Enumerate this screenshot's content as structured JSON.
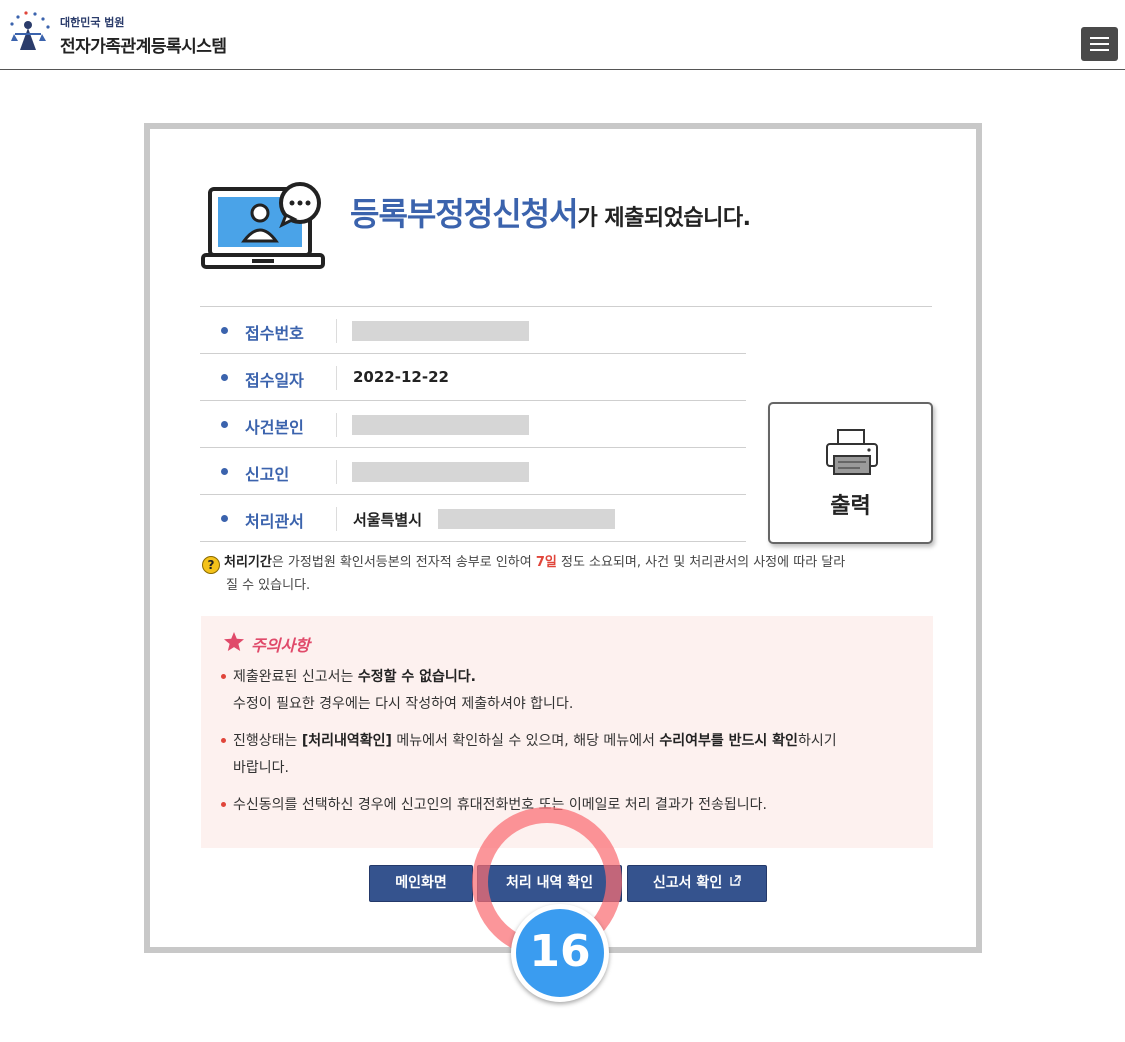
{
  "header": {
    "org_name": "대한민국 법원",
    "system_name": "전자가족관계등록시스템"
  },
  "hero": {
    "title": "등록부정정신청서",
    "title_suffix": "가 제출되었습니다."
  },
  "info_rows": [
    {
      "label": "접수번호",
      "value": ""
    },
    {
      "label": "접수일자",
      "value": "2022-12-22"
    },
    {
      "label": "사건본인",
      "value": ""
    },
    {
      "label": "신고인",
      "value": ""
    },
    {
      "label": "처리관서",
      "value": "서울특별시"
    }
  ],
  "print_button": {
    "label": "출력"
  },
  "note": {
    "strong": "처리기간",
    "text1": "은 가정법원 확인서등본의 전자적 송부로 인하여 ",
    "highlight": "7일",
    "text2": " 정도 소요되며, 사건 및 처리관서의 사정에 따라 달라",
    "text3": "질 수 있습니다."
  },
  "caution": {
    "title": "주의사항",
    "items": [
      {
        "pre": "제출완료된 신고서는 ",
        "bold": "수정할 수 없습니다.",
        "line2": "수정이 필요한 경우에는 다시 작성하여 제출하셔야 합니다."
      },
      {
        "pre": "진행상태는 ",
        "bold1": "[처리내역확인]",
        "mid": " 메뉴에서 확인하실 수 있으며, 해당 메뉴에서 ",
        "bold2": "수리여부를 반드시 확인",
        "post": "하시기",
        "line2": "바랍니다."
      },
      {
        "text": "수신동의를 선택하신 경우에 신고인의 휴대전화번호 또는 이메일로 처리 결과가 전송됩니다."
      }
    ]
  },
  "buttons": {
    "main": "메인화면",
    "history": "처리 내역 확인",
    "report": "신고서 확인"
  },
  "annotation": {
    "step_number": "16"
  },
  "colors": {
    "brand_blue": "#3b63ad",
    "button_navy": "#35538e",
    "caution_bg": "#fdf1ef",
    "highlight_red": "#e0453a",
    "badge_blue": "#3a9cf0"
  },
  "icons": [
    "court-logo-icon",
    "menu-icon",
    "laptop-user-icon",
    "printer-icon",
    "question-icon",
    "star-icon",
    "external-link-icon"
  ]
}
